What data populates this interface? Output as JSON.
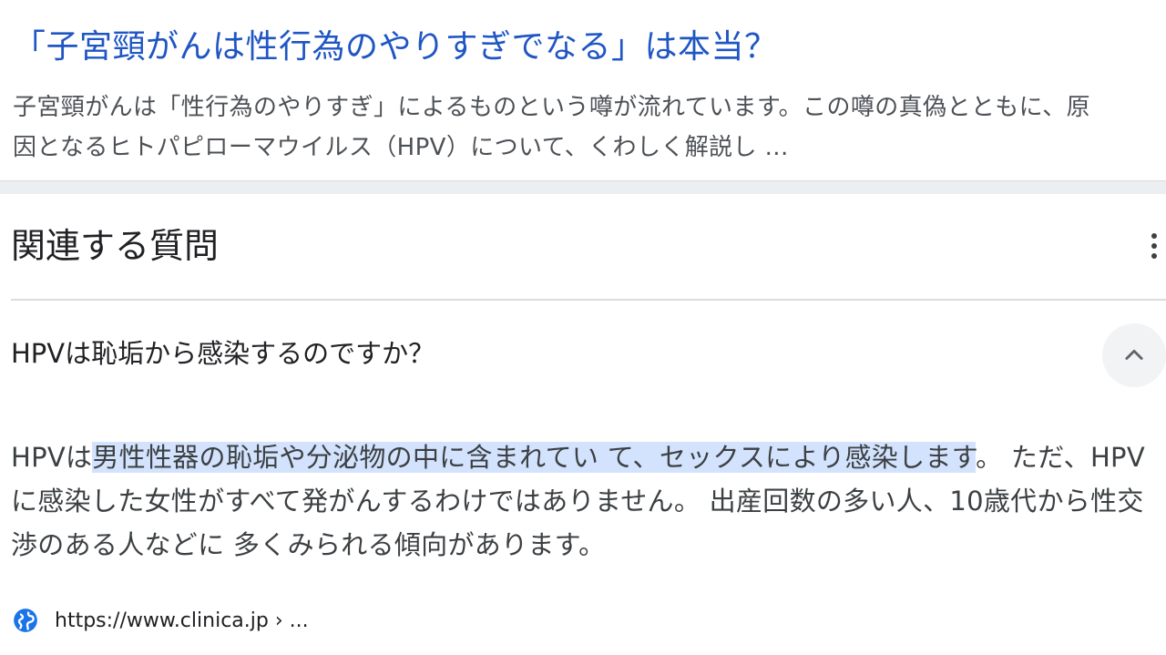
{
  "result": {
    "title": "「子宮頸がんは性行為のやりすぎでなる」は本当？",
    "snippet_line1": "子宮頸がんは「性行為のやりすぎ」によるものという噂が流れています。この噂の真偽とともに、原",
    "snippet_line2": "因となるヒトパピローマウイルス（HPV）について、くわしく解説し ..."
  },
  "related_questions": {
    "heading": "関連する質問",
    "more_icon": "more-vert-icon",
    "items": [
      {
        "question": "HPVは恥垢から感染するのですか？",
        "toggle_icon": "chevron-up-icon",
        "answer": {
          "prefix": "HPVは",
          "highlight": "男性性器の恥垢や分泌物の中に含まれてい て、セックスにより感染します",
          "rest": "。 ただ、HPVに感染した女性がすべて発がんするわけではありません。 出産回数の多い人、10歳代から性交渉のある人などに 多くみられる傾向があります。"
        },
        "source": {
          "icon": "globe-icon",
          "url": "https://www.clinica.jp › ..."
        }
      }
    ]
  },
  "colors": {
    "link": "#1f56c4",
    "highlight": "#d3e3fd",
    "text": "#202124",
    "snippet": "#4d5156"
  }
}
